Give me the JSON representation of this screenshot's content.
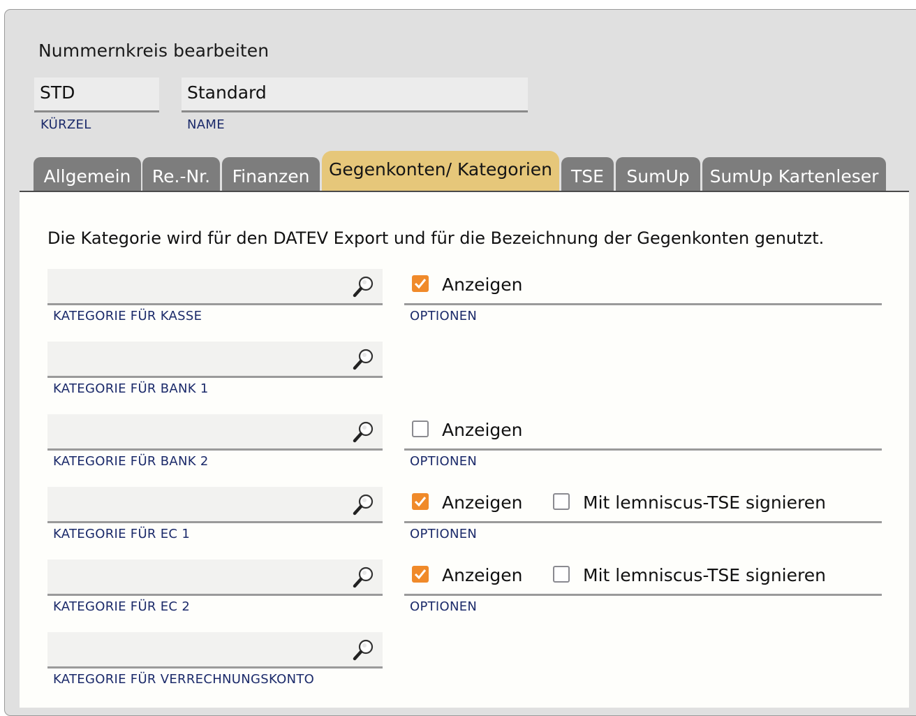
{
  "dialog": {
    "title": "Nummernkreis bearbeiten"
  },
  "fields": {
    "kuerzel": {
      "value": "STD",
      "label": "KÜRZEL"
    },
    "name": {
      "value": "Standard",
      "label": "NAME"
    }
  },
  "tabs": [
    {
      "label": "Allgemein",
      "active": false
    },
    {
      "label": "Re.-Nr.",
      "active": false
    },
    {
      "label": "Finanzen",
      "active": false
    },
    {
      "label": "Gegenkonten/ Kategorien",
      "active": true
    },
    {
      "label": "TSE",
      "active": false
    },
    {
      "label": "SumUp",
      "active": false
    },
    {
      "label": "SumUp Kartenleser",
      "active": false
    }
  ],
  "panel": {
    "intro": "Die Kategorie wird für den DATEV Export und für die Bezeichnung der Gegenkonten genutzt.",
    "options_label": "OPTIONEN",
    "anzeigen_label": "Anzeigen",
    "tse_label": "Mit lemniscus-TSE signieren",
    "categories": [
      {
        "label": "KATEGORIE FÜR KASSE",
        "value": "",
        "anzeigen": true
      },
      {
        "label": "KATEGORIE FÜR BANK 1",
        "value": ""
      },
      {
        "label": "KATEGORIE FÜR BANK 2",
        "value": "",
        "anzeigen": false
      },
      {
        "label": "KATEGORIE FÜR EC 1",
        "value": "",
        "anzeigen": true,
        "tse": false
      },
      {
        "label": "KATEGORIE FÜR EC 2",
        "value": "",
        "anzeigen": true,
        "tse": false
      },
      {
        "label": "KATEGORIE FÜR VERRECHNUNGSKONTO",
        "value": ""
      }
    ]
  },
  "colors": {
    "active_tab": "#e6c77a",
    "tab": "#7d7d7d",
    "checkbox_on": "#f08a2a",
    "label_text": "#1b2a6a"
  },
  "icons": {
    "search": "magnifier-icon",
    "check": "checkmark-icon"
  }
}
